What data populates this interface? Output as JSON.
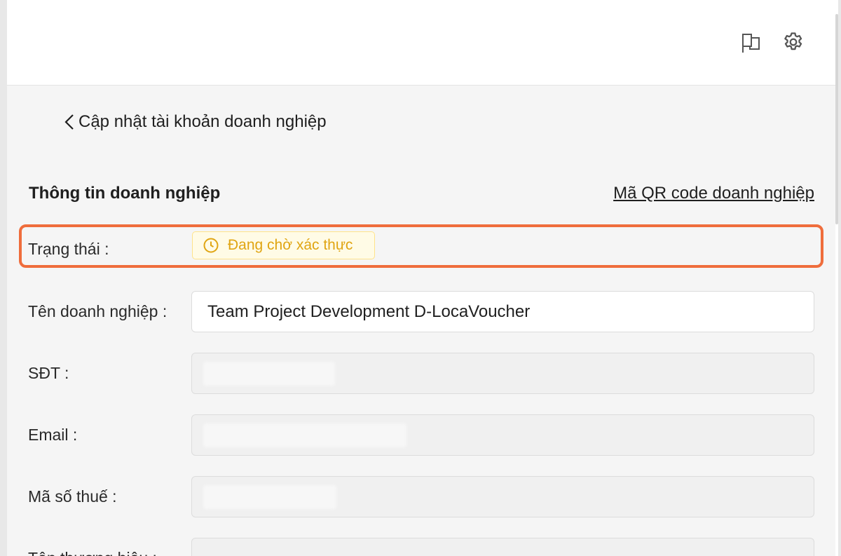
{
  "header": {
    "icons": [
      "flag-icon",
      "gear-icon"
    ]
  },
  "page": {
    "back_label": "Cập nhật tài khoản doanh nghiệp"
  },
  "section": {
    "title": "Thông tin doanh nghiệp",
    "qr_link": "Mã QR code doanh nghiệp"
  },
  "status": {
    "label": "Trạng thái :",
    "value": "Đang chờ xác thực",
    "color": "#e0a512",
    "highlight_color": "#ef6d3c"
  },
  "fields": {
    "company_name": {
      "label": "Tên doanh nghiệp :",
      "value": "Team Project Development D-LocaVoucher"
    },
    "phone": {
      "label": "SĐT :",
      "value": ""
    },
    "email": {
      "label": "Email :",
      "value": ""
    },
    "tax_code": {
      "label": "Mã số thuế :",
      "value": ""
    },
    "brand_name": {
      "label": "Tên thương hiệu :"
    }
  }
}
